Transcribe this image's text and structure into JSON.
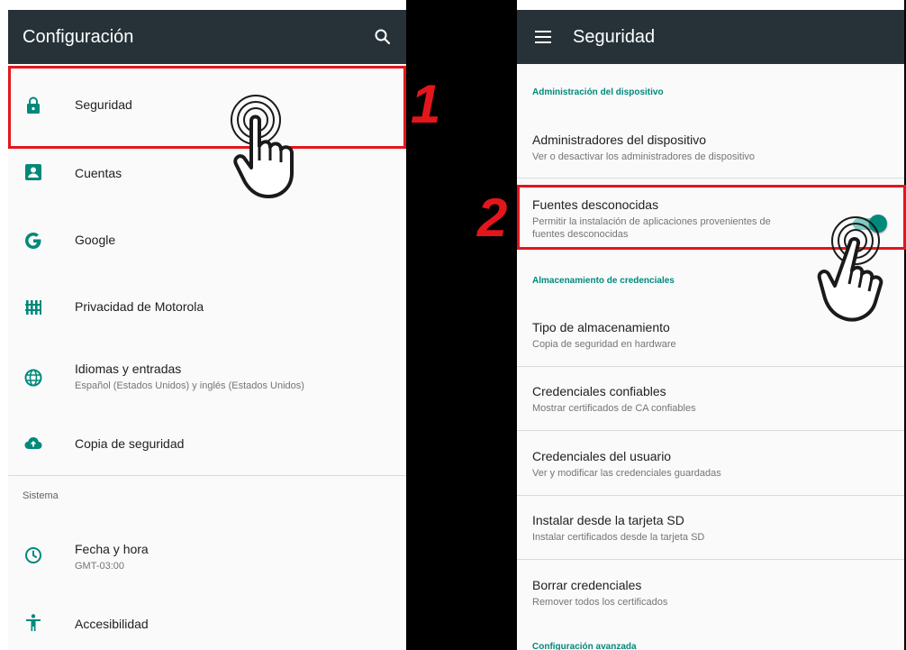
{
  "left_panel": {
    "title": "Configuración",
    "items": [
      {
        "title": "Seguridad",
        "subtitle": "",
        "icon": "lock-icon"
      },
      {
        "title": "Cuentas",
        "subtitle": "",
        "icon": "account-box-icon"
      },
      {
        "title": "Google",
        "subtitle": "",
        "icon": "google-icon"
      },
      {
        "title": "Privacidad de Motorola",
        "subtitle": "",
        "icon": "privacy-fence-icon"
      },
      {
        "title": "Idiomas y entradas",
        "subtitle": "Español (Estados Unidos) y inglés (Estados Unidos)",
        "icon": "globe-icon"
      },
      {
        "title": "Copia de seguridad",
        "subtitle": "",
        "icon": "cloud-upload-icon"
      }
    ],
    "section_label": "Sistema",
    "system_items": [
      {
        "title": "Fecha y hora",
        "subtitle": "GMT-03:00",
        "icon": "clock-icon"
      },
      {
        "title": "Accesibilidad",
        "subtitle": "",
        "icon": "accessibility-icon"
      }
    ]
  },
  "right_panel": {
    "title": "Seguridad",
    "categories": {
      "device_admin": "Administración del dispositivo",
      "credentials": "Almacenamiento de credenciales",
      "advanced": "Configuración avanzada"
    },
    "items": [
      {
        "title": "Administradores del dispositivo",
        "subtitle": "Ver o desactivar los administradores de dispositivo"
      },
      {
        "title": "Fuentes desconocidas",
        "subtitle": "Permitir la instalación de aplicaciones provenientes de",
        "subtitle2": "fuentes desconocidas",
        "toggle_on": true
      },
      {
        "title": "Tipo de almacenamiento",
        "subtitle": "Copia de seguridad en hardware"
      },
      {
        "title": "Credenciales confiables",
        "subtitle": "Mostrar certificados de CA confiables"
      },
      {
        "title": "Credenciales del usuario",
        "subtitle": "Ver y modificar las credenciales guardadas"
      },
      {
        "title": "Instalar desde la tarjeta SD",
        "subtitle": "Instalar certificados desde la tarjeta SD"
      },
      {
        "title": "Borrar credenciales",
        "subtitle": "Remover todos los certificados"
      }
    ]
  },
  "annotations": {
    "step1": "1",
    "step2": "2",
    "highlight_color": "#e3161b"
  },
  "colors": {
    "appbar": "#263238",
    "accent": "#00897b",
    "background": "#fafafa"
  }
}
